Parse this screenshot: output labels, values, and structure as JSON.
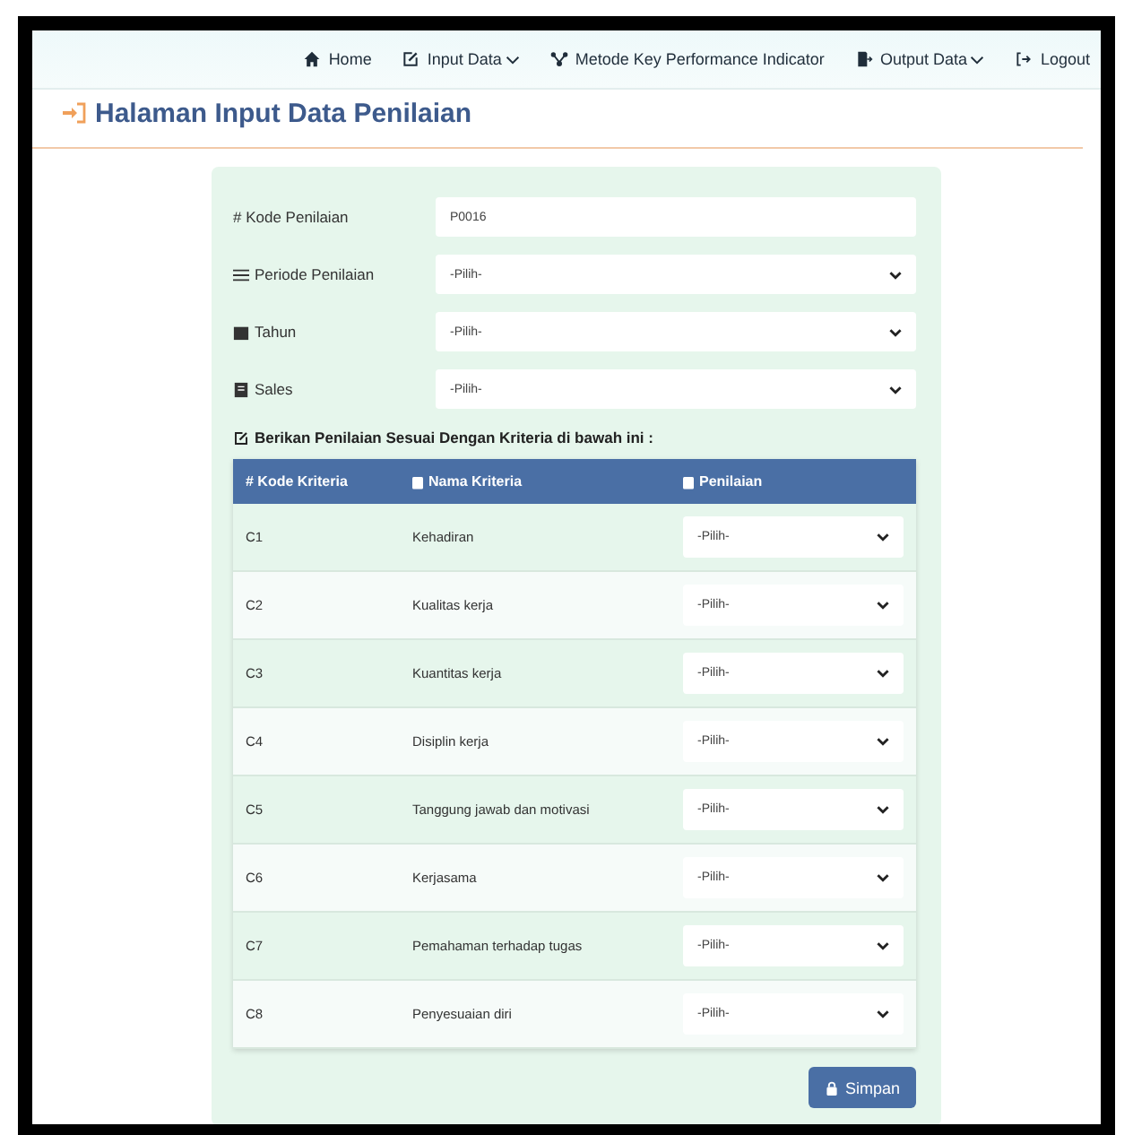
{
  "nav": [
    {
      "label": "Home",
      "kind": "home",
      "caret": false
    },
    {
      "label": "Input Data",
      "kind": "edit",
      "caret": true
    },
    {
      "label": "Metode Key Performance Indicator",
      "kind": "network",
      "caret": false
    },
    {
      "label": "Output Data",
      "kind": "export",
      "caret": true
    },
    {
      "label": "Logout",
      "kind": "logout",
      "caret": false
    }
  ],
  "page_title": "Halaman Input Data Penilaian",
  "fields": [
    {
      "label": "# Kode Penilaian",
      "kind": "input",
      "value": "P0016"
    },
    {
      "label": "Periode Penilaian",
      "kind": "select",
      "value": "-Pilih-"
    },
    {
      "label": "Tahun",
      "kind": "select",
      "value": "-Pilih-"
    },
    {
      "label": "Sales",
      "kind": "select",
      "value": "-Pilih-"
    }
  ],
  "section_heading": "Berikan Penilaian Sesuai Dengan Kriteria di bawah ini :",
  "table": {
    "columns": [
      "# Kode Kriteria",
      "Nama Kriteria",
      "Penilaian"
    ],
    "rows": [
      {
        "code": "C1",
        "name": "Kehadiran",
        "rating": "-Pilih-"
      },
      {
        "code": "C2",
        "name": "Kualitas kerja",
        "rating": "-Pilih-"
      },
      {
        "code": "C3",
        "name": "Kuantitas kerja",
        "rating": "-Pilih-"
      },
      {
        "code": "C4",
        "name": "Disiplin kerja",
        "rating": "-Pilih-"
      },
      {
        "code": "C5",
        "name": "Tanggung jawab dan motivasi",
        "rating": "-Pilih-"
      },
      {
        "code": "C6",
        "name": "Kerjasama",
        "rating": "-Pilih-"
      },
      {
        "code": "C7",
        "name": "Pemahaman terhadap tugas",
        "rating": "-Pilih-"
      },
      {
        "code": "C8",
        "name": "Penyesuaian diri",
        "rating": "-Pilih-"
      }
    ]
  },
  "save_button": "Simpan"
}
